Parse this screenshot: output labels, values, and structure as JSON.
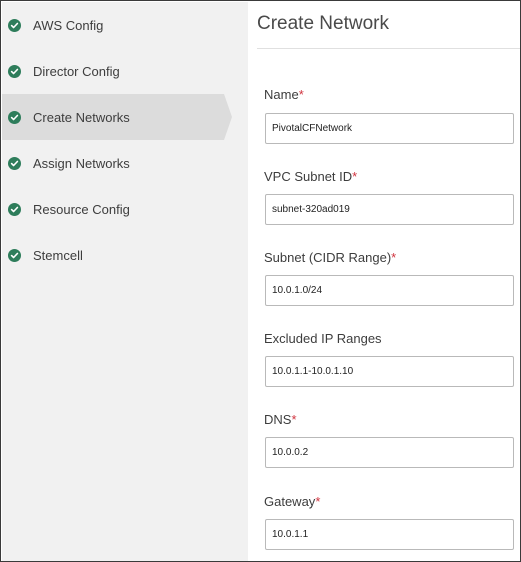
{
  "sidebar": {
    "items": [
      {
        "label": "AWS Config",
        "status": "complete",
        "active": false
      },
      {
        "label": "Director Config",
        "status": "complete",
        "active": false
      },
      {
        "label": "Create Networks",
        "status": "complete",
        "active": true
      },
      {
        "label": "Assign Networks",
        "status": "complete",
        "active": false
      },
      {
        "label": "Resource Config",
        "status": "complete",
        "active": false
      },
      {
        "label": "Stemcell",
        "status": "complete",
        "active": false
      }
    ]
  },
  "main": {
    "title": "Create Network",
    "required_marker": "*",
    "fields": [
      {
        "label": "Name",
        "required": true,
        "value": "PivotalCFNetwork"
      },
      {
        "label": "VPC Subnet ID",
        "required": true,
        "value": "subnet-320ad019"
      },
      {
        "label": "Subnet (CIDR Range)",
        "required": true,
        "value": "10.0.1.0/24"
      },
      {
        "label": "Excluded IP Ranges",
        "required": false,
        "value": "10.0.1.1-10.0.1.10"
      },
      {
        "label": "DNS",
        "required": true,
        "value": "10.0.0.2"
      },
      {
        "label": "Gateway",
        "required": true,
        "value": "10.0.1.1"
      }
    ]
  },
  "colors": {
    "check": "#2e7d5b",
    "required": "#d0333e",
    "sidebar_bg": "#f1f1f1",
    "active_bg": "#dcdcdc"
  }
}
